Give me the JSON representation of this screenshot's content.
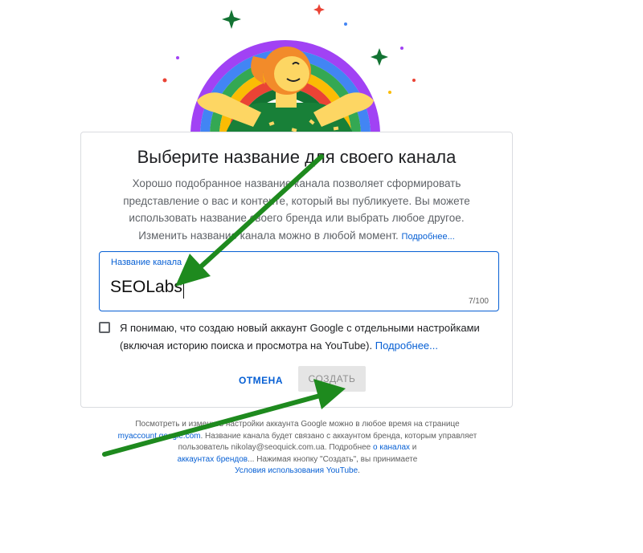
{
  "dialog": {
    "title": "Выберите название для своего канала",
    "description": "Хорошо подобранное название канала позволяет сформировать представление о вас и контенте, который вы публикуете. Вы можете использовать название своего бренда или выбрать любое другое. Изменить название канала можно в любой момент.",
    "more_link": "Подробнее..."
  },
  "name_field": {
    "label": "Название канала",
    "value": "SEOLabs",
    "counter": "7/100"
  },
  "agreement": {
    "text": "Я понимаю, что создаю новый аккаунт Google с отдельными настройками (включая историю поиска и просмотра на YouTube).",
    "link": "Подробнее...",
    "checked": false
  },
  "buttons": {
    "cancel": "ОТМЕНА",
    "create": "СОЗДАТЬ"
  },
  "footer": {
    "part1": "Посмотреть и изменить настройки аккаунта Google можно в любое время на странице",
    "link_myaccount": "myaccount.google.com",
    "part2": ". Название канала будет связано с аккаунтом бренда, которым управляет пользователь nikolay@seoquick.com.ua. Подробнее",
    "link_channels": "о каналах",
    "part3": "и",
    "link_brands": "аккаунтах брендов",
    "part4": "... Нажимая кнопку \"Создать\", вы принимаете",
    "link_terms": "Условия использования YouTube",
    "part5": "."
  },
  "colors": {
    "link": "#065fd4",
    "annotation_arrow": "#1e8a1e",
    "field_border": "#065fd4",
    "disabled_button": "#e5e5e5"
  },
  "icons": [
    "rainbow-illustration",
    "sparkle-icon",
    "annotation-arrow"
  ]
}
